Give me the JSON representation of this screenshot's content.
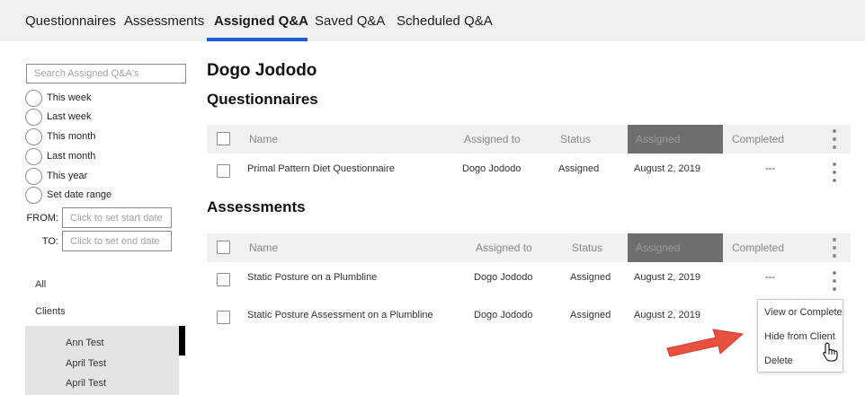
{
  "tabs": [
    {
      "label": "Questionnaires"
    },
    {
      "label": "Assessments"
    },
    {
      "label": "Assigned Q&A"
    },
    {
      "label": "Saved Q&A"
    },
    {
      "label": "Scheduled Q&A"
    }
  ],
  "active_tab": "Assigned Q&A",
  "sidebar": {
    "search_placeholder": "Search Assigned Q&A's",
    "date_filters": [
      {
        "label": "This week"
      },
      {
        "label": "Last week"
      },
      {
        "label": "This month"
      },
      {
        "label": "Last month"
      },
      {
        "label": "This year"
      },
      {
        "label": "Set date range"
      }
    ],
    "from_label": "FROM:",
    "from_placeholder": "Click to set start date",
    "to_label": "TO:",
    "to_placeholder": "Click to set end date",
    "filters": [
      {
        "label": "All"
      },
      {
        "label": "Clients"
      }
    ],
    "clients": [
      {
        "name": "Ann Test"
      },
      {
        "name": "April Test"
      },
      {
        "name": "April Test"
      }
    ]
  },
  "main": {
    "client_name": "Dogo Jododo",
    "questionnaires": {
      "title": "Questionnaires",
      "columns": {
        "name": "Name",
        "assigned_to": "Assigned to",
        "status": "Status",
        "assigned": "Assigned",
        "completed": "Completed"
      },
      "rows": [
        {
          "name": "Primal Pattern Diet Questionnaire",
          "assigned_to": "Dogo Jododo",
          "status": "Assigned",
          "assigned": "August 2, 2019",
          "completed": "---"
        }
      ]
    },
    "assessments": {
      "title": "Assessments",
      "columns": {
        "name": "Name",
        "assigned_to": "Assigned to",
        "status": "Status",
        "assigned": "Assigned",
        "completed": "Completed"
      },
      "rows": [
        {
          "name": "Static Posture on a Plumbline",
          "assigned_to": "Dogo Jododo",
          "status": "Assigned",
          "assigned": "August 2, 2019",
          "completed": "---"
        },
        {
          "name": "Static Posture Assessment on a Plumbline",
          "assigned_to": "Dogo Jododo",
          "status": "Assigned",
          "assigned": "August 2, 2019",
          "completed": ""
        }
      ]
    }
  },
  "context_menu": {
    "items": [
      {
        "label": "View or Complete"
      },
      {
        "label": "Hide from Client"
      },
      {
        "label": "Delete"
      }
    ]
  },
  "colors": {
    "accent": "#1e5fd8",
    "arrow": "#e8503f",
    "header_bg": "#eff0f2",
    "topbar_bg": "#eef0f2"
  }
}
